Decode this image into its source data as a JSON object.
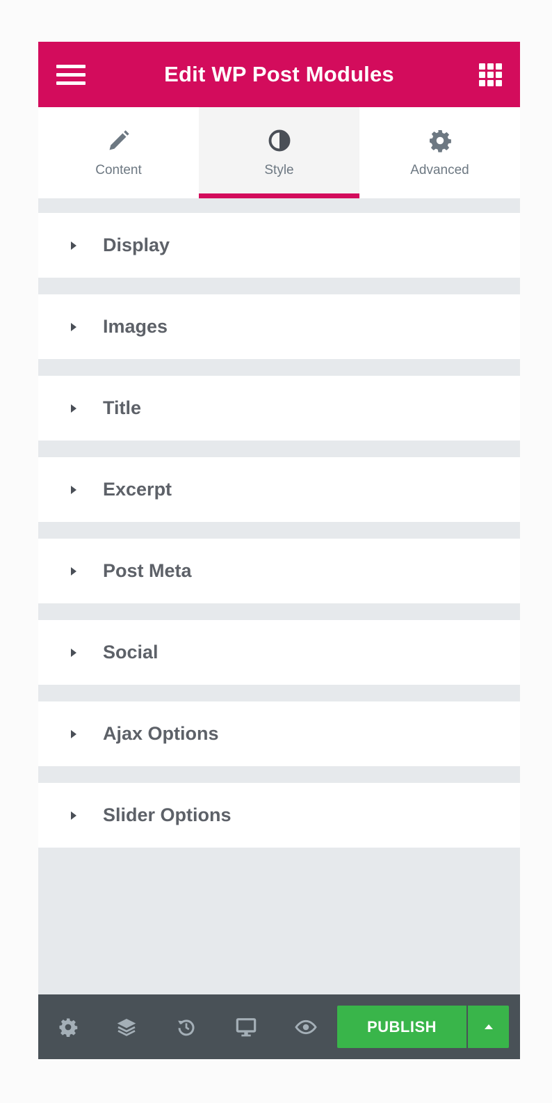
{
  "header": {
    "title": "Edit WP Post Modules",
    "menu_icon": "hamburger-icon",
    "apps_icon": "grid-icon",
    "accent_color": "#d30c5c"
  },
  "tabs": [
    {
      "label": "Content",
      "icon": "pencil-icon",
      "active": false
    },
    {
      "label": "Style",
      "icon": "half-circle-icon",
      "active": true
    },
    {
      "label": "Advanced",
      "icon": "gear-icon",
      "active": false
    }
  ],
  "sections": [
    {
      "label": "Display"
    },
    {
      "label": "Images"
    },
    {
      "label": "Title"
    },
    {
      "label": "Excerpt"
    },
    {
      "label": "Post Meta"
    },
    {
      "label": "Social"
    },
    {
      "label": "Ajax Options"
    },
    {
      "label": "Slider Options"
    }
  ],
  "footer": {
    "icons": [
      "settings-icon",
      "layers-icon",
      "history-icon",
      "responsive-icon",
      "preview-icon"
    ],
    "publish_label": "PUBLISH",
    "publish_color": "#39b54a",
    "background": "#495157"
  }
}
